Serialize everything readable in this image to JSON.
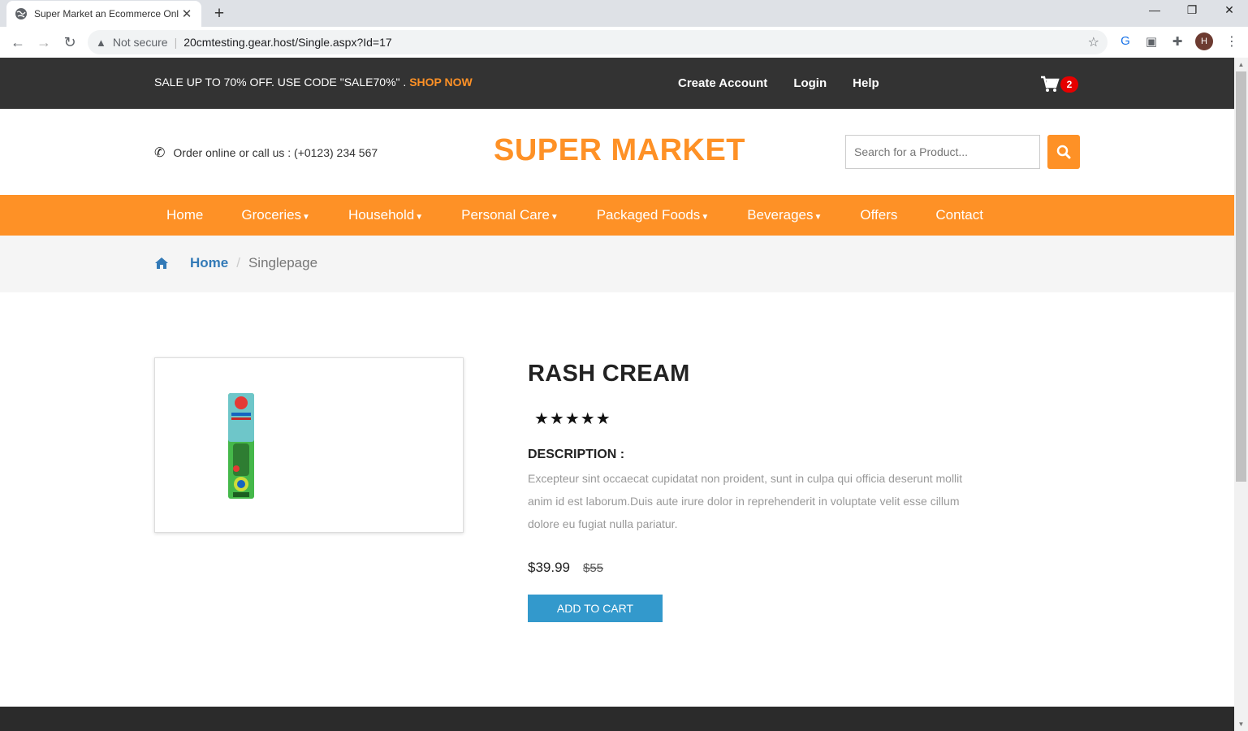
{
  "browser": {
    "tab_title": "Super Market an Ecommerce Onl",
    "tab_close": "✕",
    "new_tab": "+",
    "security_label": "Not secure",
    "url": "20cmtesting.gear.host/Single.aspx?Id=17",
    "profile_initial": "H",
    "window_controls": {
      "minimize": "—",
      "restore": "❐",
      "close": "✕"
    }
  },
  "topbar": {
    "promo_text": "SALE UP TO 70% OFF. USE CODE \"SALE70%\" .",
    "promo_link": "SHOP NOW",
    "links": [
      "Create Account",
      "Login",
      "Help"
    ],
    "cart_count": "2"
  },
  "header": {
    "phone_text": "Order online or call us : (+0123) 234 567",
    "logo": "SUPER MARKET",
    "search_placeholder": "Search for a Product..."
  },
  "nav": {
    "items": [
      {
        "label": "Home",
        "dropdown": false
      },
      {
        "label": "Groceries",
        "dropdown": true
      },
      {
        "label": "Household",
        "dropdown": true
      },
      {
        "label": "Personal Care",
        "dropdown": true
      },
      {
        "label": "Packaged Foods",
        "dropdown": true
      },
      {
        "label": "Beverages",
        "dropdown": true
      },
      {
        "label": "Offers",
        "dropdown": false
      },
      {
        "label": "Contact",
        "dropdown": false
      }
    ]
  },
  "breadcrumb": {
    "home": "Home",
    "separator": "/",
    "current": "Singlepage"
  },
  "product": {
    "name": "RASH CREAM",
    "rating": "★★★★★",
    "description_heading": "DESCRIPTION :",
    "description": "Excepteur sint occaecat cupidatat non proident, sunt in culpa qui officia deserunt mollit anim id est laborum.Duis aute irure dolor in reprehenderit in voluptate velit esse cillum dolore eu fugiat nulla pariatur.",
    "price": "$39.99",
    "old_price": "$55",
    "add_to_cart": "ADD TO CART"
  },
  "colors": {
    "accent": "#fe9126",
    "topbar": "#333333",
    "link": "#337ab7",
    "button": "#3399cc",
    "badge": "#e60000"
  }
}
